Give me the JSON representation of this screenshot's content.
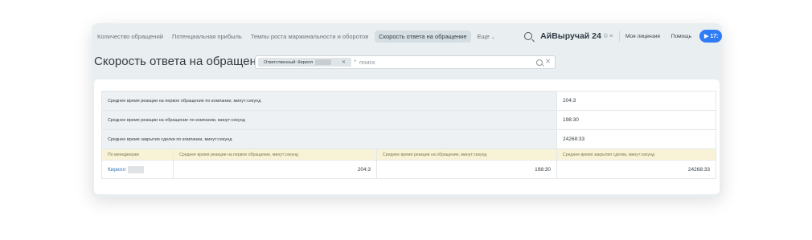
{
  "nav": {
    "tabs": [
      {
        "label": "Количество обращений"
      },
      {
        "label": "Потенциальная прибыль"
      },
      {
        "label": "Темпы роста маржинальности и оборотов"
      },
      {
        "label": "Скорость ответа на обращение"
      }
    ],
    "more_label": "Еще",
    "brand": "АйВыручай 24",
    "brand_extra": "© ≡",
    "license_label": "Моя лицензия",
    "help_label": "Помощь",
    "call_label": "▶ 17:"
  },
  "page": {
    "title": "Скорость ответа на обращение",
    "filter_chip": "Ответственный: Кирилл",
    "filter_plus": "+",
    "search_placeholder": "поиск"
  },
  "report": {
    "summary": [
      {
        "label": "Среднее время реакции на первое обращение по компании, минут:секунд",
        "value": "204:3"
      },
      {
        "label": "Среднее время реакции на обращение по компании, минут:секунд",
        "value": "198:30"
      },
      {
        "label": "Среднее время закрытия сделки по компании, минут:секунд",
        "value": "24268:33"
      }
    ],
    "headers": [
      "По менеджерам",
      "Среднее время реакции на первое обращение, минут:секунд",
      "Среднее время реакции на обращение, минут:секунд",
      "Среднее время закрытия сделки, минут:секунд"
    ],
    "rows": [
      {
        "manager": "Кирилл",
        "first_reaction": "204:3",
        "reaction": "198:30",
        "closing": "24268:33"
      }
    ]
  }
}
